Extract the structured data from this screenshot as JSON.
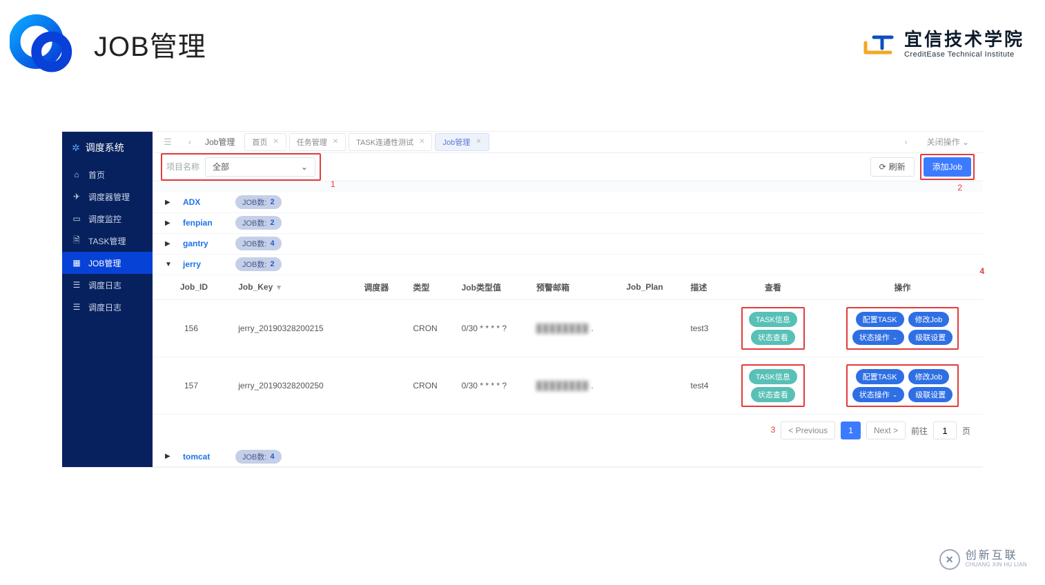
{
  "page_title": "JOB管理",
  "brand": {
    "cn": "宜信技术学院",
    "en": "CreditEase Technical Institute"
  },
  "sidebar": {
    "title": "调度系统",
    "items": [
      {
        "label": "首页",
        "icon": "home"
      },
      {
        "label": "调度器管理",
        "icon": "rocket"
      },
      {
        "label": "调度监控",
        "icon": "monitor"
      },
      {
        "label": "TASK管理",
        "icon": "doc"
      },
      {
        "label": "JOB管理",
        "icon": "grid",
        "active": true
      },
      {
        "label": "调度日志",
        "icon": "log"
      },
      {
        "label": "调度日志",
        "icon": "log"
      }
    ]
  },
  "topbar": {
    "crumb": "Job管理",
    "tabs": [
      {
        "label": "首页"
      },
      {
        "label": "任务管理"
      },
      {
        "label": "TASK连通性测试"
      },
      {
        "label": "Job管理",
        "active": true
      }
    ],
    "close_label": "关闭操作"
  },
  "filter": {
    "label": "项目名称",
    "value": "全部",
    "refresh": "刷新",
    "add": "添加Job"
  },
  "annotations": {
    "a1": "1",
    "a2": "2",
    "a3": "3",
    "a4": "4"
  },
  "groups": [
    {
      "name": "ADX",
      "count": 2,
      "expanded": false
    },
    {
      "name": "fenpian",
      "count": 2,
      "expanded": false
    },
    {
      "name": "gantry",
      "count": 4,
      "expanded": false
    },
    {
      "name": "jerry",
      "count": 2,
      "expanded": true
    },
    {
      "name": "tomcat",
      "count": 4,
      "expanded": false
    }
  ],
  "job_count_label": "JOB数:",
  "table": {
    "headers": {
      "job_id": "Job_ID",
      "job_key": "Job_Key",
      "scheduler": "调度器",
      "type": "类型",
      "type_val": "Job类型值",
      "email": "预警邮箱",
      "plan": "Job_Plan",
      "desc": "描述",
      "view": "查看",
      "ops": "操作"
    },
    "rows": [
      {
        "job_id": "156",
        "job_key": "jerry_20190328200215",
        "scheduler": "",
        "type": "CRON",
        "type_val": "0/30 * * * * ?",
        "email": "████████",
        "plan": "",
        "desc": "test3"
      },
      {
        "job_id": "157",
        "job_key": "jerry_20190328200250",
        "scheduler": "",
        "type": "CRON",
        "type_val": "0/30 * * * * ?",
        "email": "████████",
        "plan": "",
        "desc": "test4"
      }
    ],
    "view_chips": {
      "task_info": "TASK信息",
      "status_view": "状态查看"
    },
    "op_chips": {
      "cfg_task": "配置TASK",
      "edit_job": "修改Job",
      "status_op": "状态操作",
      "cascade": "级联设置"
    }
  },
  "pager": {
    "prev": "< Previous",
    "page": "1",
    "next": "Next >",
    "goto": "前往",
    "goto_val": "1",
    "unit": "页"
  },
  "watermark": {
    "cn": "创新互联",
    "py": "CHUANG XIN HU LIAN"
  }
}
